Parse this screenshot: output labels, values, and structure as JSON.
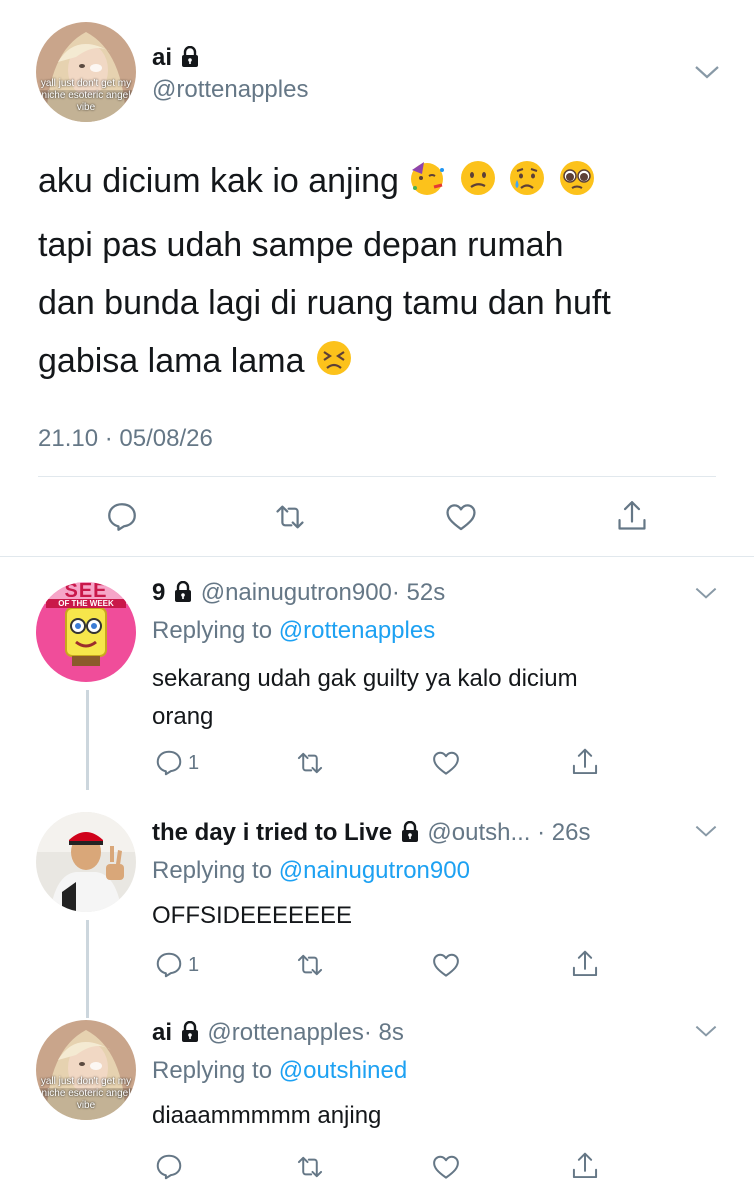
{
  "main": {
    "display_name": "ai",
    "handle": "@rottenapples",
    "avatar_caption": "yall just don't get my niche esoteric angel vibe",
    "text_lines": [
      "aku dicium kak io anjing",
      "tapi pas udah sampe depan rumah",
      "dan bunda lagi di ruang tamu dan huft",
      "gabisa lama lama"
    ],
    "emoji_line1": [
      "partying-face",
      "confused-face",
      "crying-face",
      "pleading-face"
    ],
    "emoji_line4": [
      "persevering-face"
    ],
    "timestamp": "21.10 · 05/08/26"
  },
  "replies": [
    {
      "display_name": "9",
      "handle": "@nainugutron900",
      "time": "· 52s",
      "replying_prefix": "Replying to",
      "replying_to": "@rottenapples",
      "text_lines": [
        "sekarang udah gak guilty ya kalo dicium",
        "orang"
      ],
      "avatar_text_top": "SEE",
      "avatar_text_banner": "OF THE WEEK",
      "reply_count": "1"
    },
    {
      "display_name": "the day i tried to Live",
      "handle": "@outsh...",
      "time": "· 26s",
      "replying_prefix": "Replying to",
      "replying_to": "@nainugutron900",
      "text_lines": [
        "OFFSIDEEEEEEE"
      ],
      "reply_count": "1"
    },
    {
      "display_name": "ai",
      "handle": "@rottenapples",
      "time": "· 8s",
      "replying_prefix": "Replying to",
      "replying_to": "@outshined",
      "text_lines": [
        "diaaammmmm anjing"
      ],
      "avatar_caption": "yall just don't get my niche esoteric angel vibe",
      "reply_count": ""
    }
  ],
  "colors": {
    "link": "#1da1f2",
    "secondary": "#657786",
    "divider": "#e1e8ed",
    "thread": "#ccd6dd"
  }
}
